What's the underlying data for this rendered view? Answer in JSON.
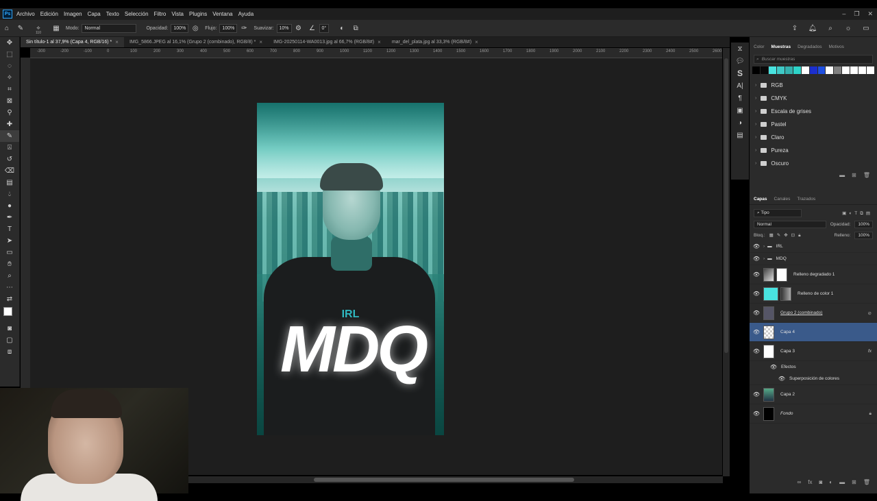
{
  "menu": [
    "Archivo",
    "Edición",
    "Imagen",
    "Capa",
    "Texto",
    "Selección",
    "Filtro",
    "Vista",
    "Plugins",
    "Ventana",
    "Ayuda"
  ],
  "options": {
    "mode_label": "Modo:",
    "mode_value": "Normal",
    "opacity_label": "Opacidad:",
    "opacity_value": "100%",
    "flow_label": "Flujo:",
    "flow_value": "100%",
    "smooth_label": "Suavizar:",
    "smooth_value": "10%",
    "angle_value": "0°",
    "brush_size": "110"
  },
  "tabs": [
    {
      "label": "Sin título-1 al 37,9% (Capa 4, RGB/16) *",
      "active": true
    },
    {
      "label": "IMG_5866.JPEG al 16,1% (Grupo 2 (combinado), RGB/8) *",
      "active": false
    },
    {
      "label": "IMG-20250114-WA0013.jpg al 66,7% (RGB/8#)",
      "active": false
    },
    {
      "label": "mar_del_plata.jpg al 33,3% (RGB/8#)",
      "active": false
    }
  ],
  "ruler_ticks": [
    "-300",
    "-200",
    "-100",
    "0",
    "100",
    "200",
    "300",
    "400",
    "500",
    "600",
    "700",
    "800",
    "900",
    "1000",
    "1100",
    "1200",
    "1300",
    "1400",
    "1500",
    "1600",
    "1700",
    "1800",
    "1900",
    "2000",
    "2100",
    "2200",
    "2300",
    "2400",
    "2500",
    "2600"
  ],
  "artwork": {
    "irl": "IRL",
    "mdq": "MDQ"
  },
  "swatches_panel": {
    "tabs": [
      "Color",
      "Muestras",
      "Degradados",
      "Motivos"
    ],
    "search_placeholder": "Buscar muestras",
    "colors": [
      "#000000",
      "#0a0a0a",
      "#49e3e0",
      "#3fc9c6",
      "#35b0ad",
      "#2dd4c8",
      "#ffffff",
      "#1c2fcf",
      "#1f4fe0",
      "#ffffff",
      "#808080",
      "#ffffff",
      "#ffffff",
      "#ffffff",
      "#ffffff"
    ],
    "folders": [
      "RGB",
      "CMYK",
      "Escala de grises",
      "Pastel",
      "Claro",
      "Pureza",
      "Oscuro"
    ]
  },
  "layers_panel": {
    "tabs": [
      "Capas",
      "Canales",
      "Trazados"
    ],
    "filter": "Tipo",
    "blend": "Normal",
    "opacity_label": "Opacidad:",
    "opacity_value": "100%",
    "lock_label": "Bloq.:",
    "fill_label": "Relleno:",
    "fill_value": "100%",
    "layers": [
      {
        "name": "IRL",
        "type": "group"
      },
      {
        "name": "MDQ",
        "type": "group"
      },
      {
        "name": "Relleno degradado 1",
        "type": "fill"
      },
      {
        "name": "Relleno de color 1",
        "type": "fill"
      },
      {
        "name": "Grupo 2 (combinado)",
        "type": "layer"
      },
      {
        "name": "Capa 4",
        "type": "layer",
        "selected": true
      },
      {
        "name": "Capa 3",
        "type": "layer",
        "fx": "fx"
      },
      {
        "name": "Efectos",
        "type": "effects"
      },
      {
        "name": "Superposición de colores",
        "type": "effect"
      },
      {
        "name": "Capa 2",
        "type": "layer"
      },
      {
        "name": "Fondo",
        "type": "background"
      }
    ]
  },
  "colors": {
    "accent": "#31a8ff",
    "selection": "#3a5a8a",
    "canvas_bg": "#1e1e1e",
    "panel_bg": "#2b2b2b"
  }
}
